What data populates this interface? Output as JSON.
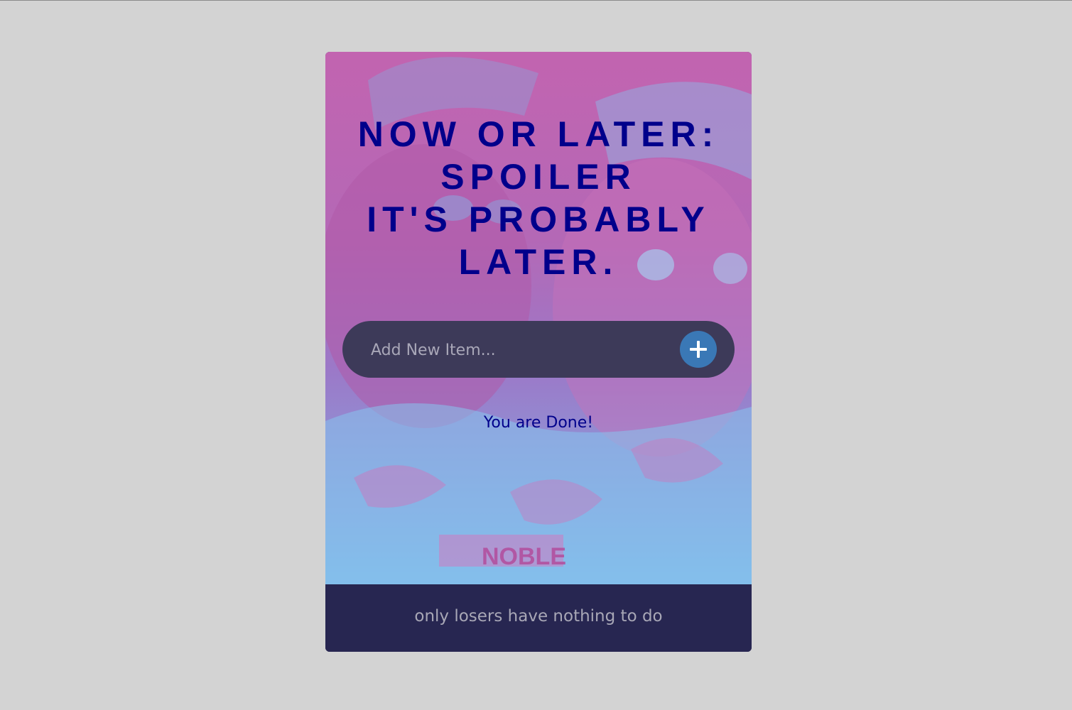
{
  "page": {
    "title_lines": [
      "NOW OR LATER:",
      "SPOILER",
      "IT'S PROBABLY",
      "LATER."
    ],
    "hero_image_alt": "Two soldiers in camouflage, tinted pink and blue",
    "name_tape": "NOBLE"
  },
  "add_item": {
    "placeholder": "Add New Item...",
    "value": "",
    "button_icon": "plus-icon"
  },
  "status": {
    "message": "You are Done!"
  },
  "footer": {
    "text": "only losers have nothing to do"
  },
  "colors": {
    "page_background": "#d3d3d3",
    "title": "#00008b",
    "input_bar": "#3d3a59",
    "add_button": "#3a78b6",
    "footer": "#272651",
    "footer_text": "#a8a7b6"
  }
}
